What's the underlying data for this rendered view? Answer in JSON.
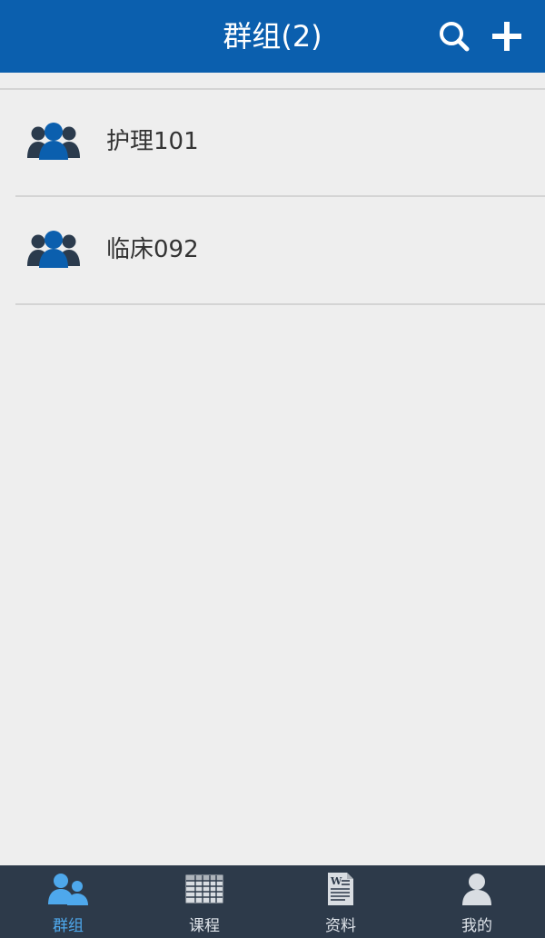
{
  "header": {
    "title": "群组(2)",
    "background": "#0b5fae",
    "search_icon": "search-icon",
    "add_icon": "plus-icon"
  },
  "groups": [
    {
      "name": "护理101",
      "icon": "group-icon"
    },
    {
      "name": "临床092",
      "icon": "group-icon"
    }
  ],
  "tabbar": {
    "active_color": "#4ea8ec",
    "background": "#2d3a4a",
    "tabs": [
      {
        "label": "群组",
        "icon": "group-icon",
        "active": true
      },
      {
        "label": "课程",
        "icon": "schedule-table-icon",
        "active": false
      },
      {
        "label": "资料",
        "icon": "document-icon",
        "active": false
      },
      {
        "label": "我的",
        "icon": "user-icon",
        "active": false
      }
    ]
  }
}
